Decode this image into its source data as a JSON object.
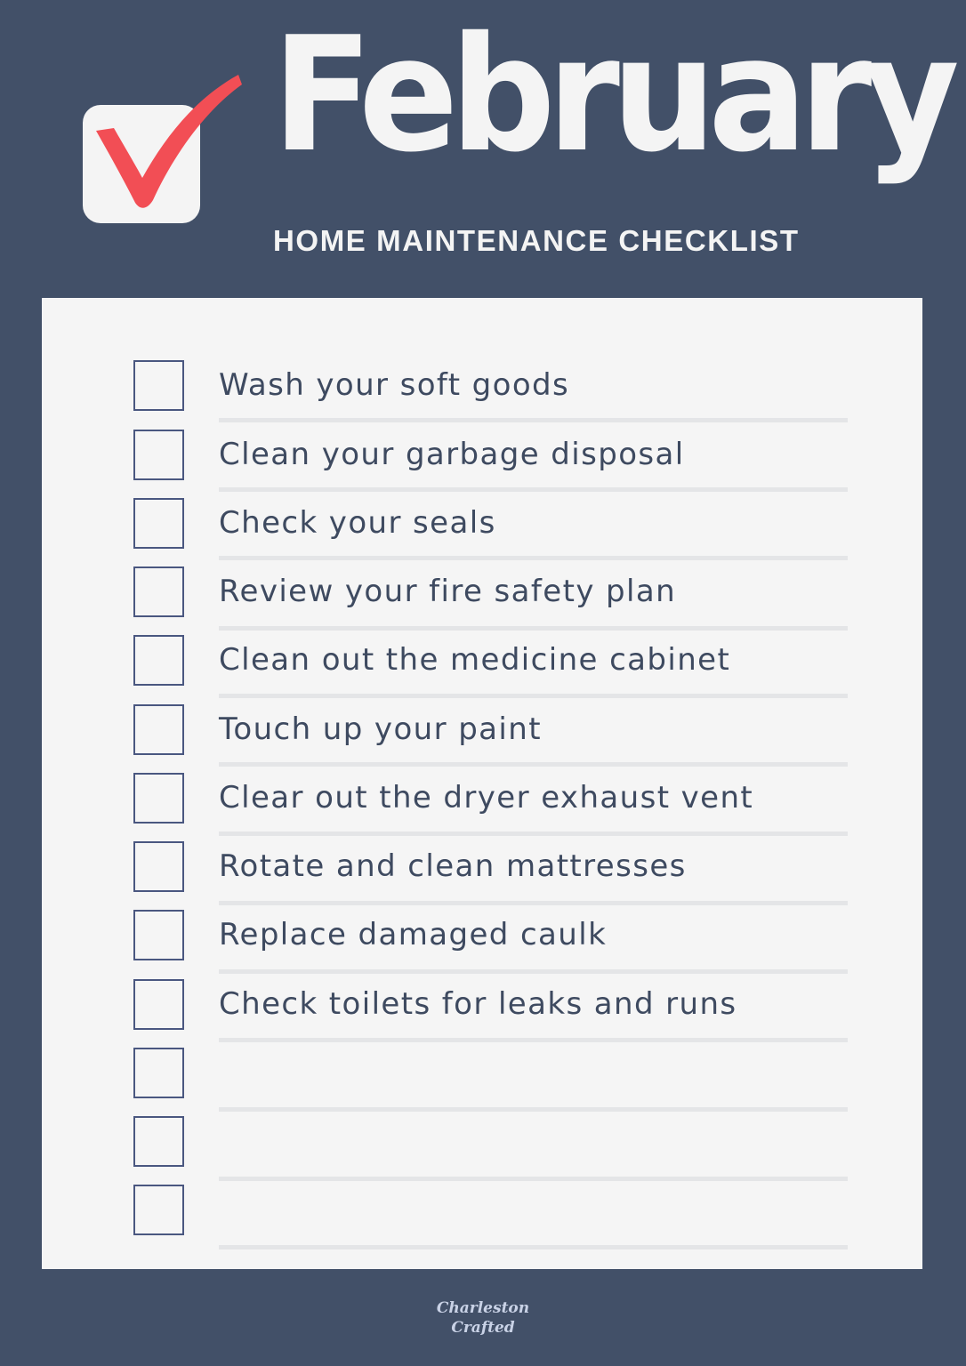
{
  "header": {
    "title": "February",
    "subtitle": "HOME MAINTENANCE CHECKLIST",
    "logo_icon": "checkmark-in-box-icon"
  },
  "colors": {
    "background": "#425068",
    "card": "#f5f5f5",
    "checkmark": "#f24e55",
    "checkbox_border": "#4a5780",
    "text": "#3e4a60",
    "divider": "#e4e5e7"
  },
  "checklist": {
    "items": [
      {
        "label": "Wash your soft goods",
        "checked": false
      },
      {
        "label": "Clean your garbage disposal",
        "checked": false
      },
      {
        "label": "Check your seals",
        "checked": false
      },
      {
        "label": "Review your fire safety plan",
        "checked": false
      },
      {
        "label": "Clean out the medicine cabinet",
        "checked": false
      },
      {
        "label": "Touch up your paint",
        "checked": false
      },
      {
        "label": "Clear out the dryer exhaust vent",
        "checked": false
      },
      {
        "label": "Rotate and clean mattresses",
        "checked": false
      },
      {
        "label": "Replace damaged caulk",
        "checked": false
      },
      {
        "label": "Check toilets for leaks and runs",
        "checked": false
      },
      {
        "label": "",
        "checked": false
      },
      {
        "label": "",
        "checked": false
      },
      {
        "label": "",
        "checked": false
      }
    ]
  },
  "footer": {
    "brand_line1": "Charleston",
    "brand_line2": "Crafted"
  }
}
